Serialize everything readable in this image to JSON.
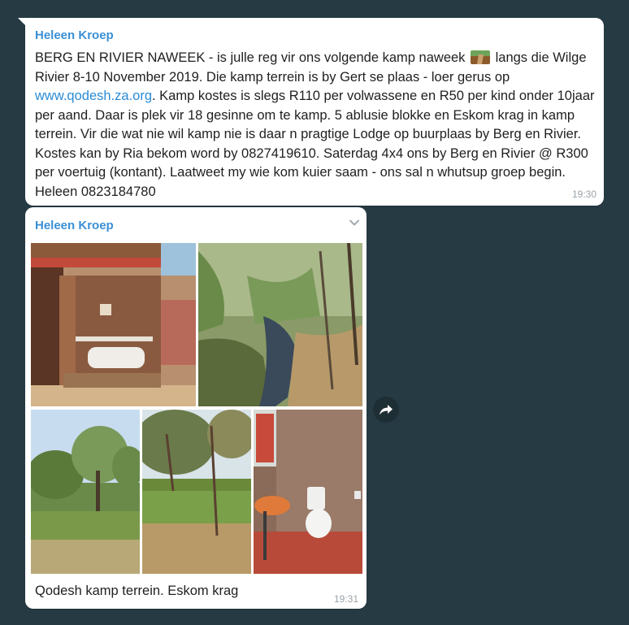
{
  "messages": [
    {
      "sender": "Heleen Kroep",
      "text_part1": "BERG EN RIVIER NAWEEK - is julle reg vir ons volgende kamp naweek ",
      "emoji_icon": "railway-track-emoji",
      "text_part2": " langs die Wilge Rivier 8-10 November 2019. Die kamp terrein is by Gert se plaas - loer gerus op ",
      "link": "www.qodesh.za.org",
      "text_part3": ". Kamp kostes is slegs R110 per volwassene en R50 per kind onder 10jaar per aand. Daar is plek vir 18 gesinne om te kamp. 5 ablusie blokke en Eskom krag in kamp terrein. Vir die wat nie wil kamp nie is daar n pragtige Lodge op buurplaas by Berg en Rivier. Kostes kan by Ria bekom word by 0827419610. Saterdag 4x4 ons by Berg en Rivier @ R300 per voertuig (kontant). Laatweet my wie kom kuier saam - ons sal n whutsup groep begin. Heleen 0823184780",
      "time": "19:30"
    },
    {
      "sender": "Heleen Kroep",
      "caption": "Qodesh kamp terrein. Eskom krag",
      "time": "19:31",
      "photos": [
        "ablution-block-photo",
        "river-photo",
        "campsite-trees-photo",
        "campsite-lawn-photo",
        "bathroom-photo"
      ]
    }
  ],
  "colors": {
    "background": "#263a43",
    "bubble": "#ffffff",
    "sender": "#3a8fd6",
    "link": "#2a8bd6",
    "time": "#9aa3a8"
  },
  "icons": {
    "menu": "chevron-down-icon",
    "share": "share-icon"
  }
}
